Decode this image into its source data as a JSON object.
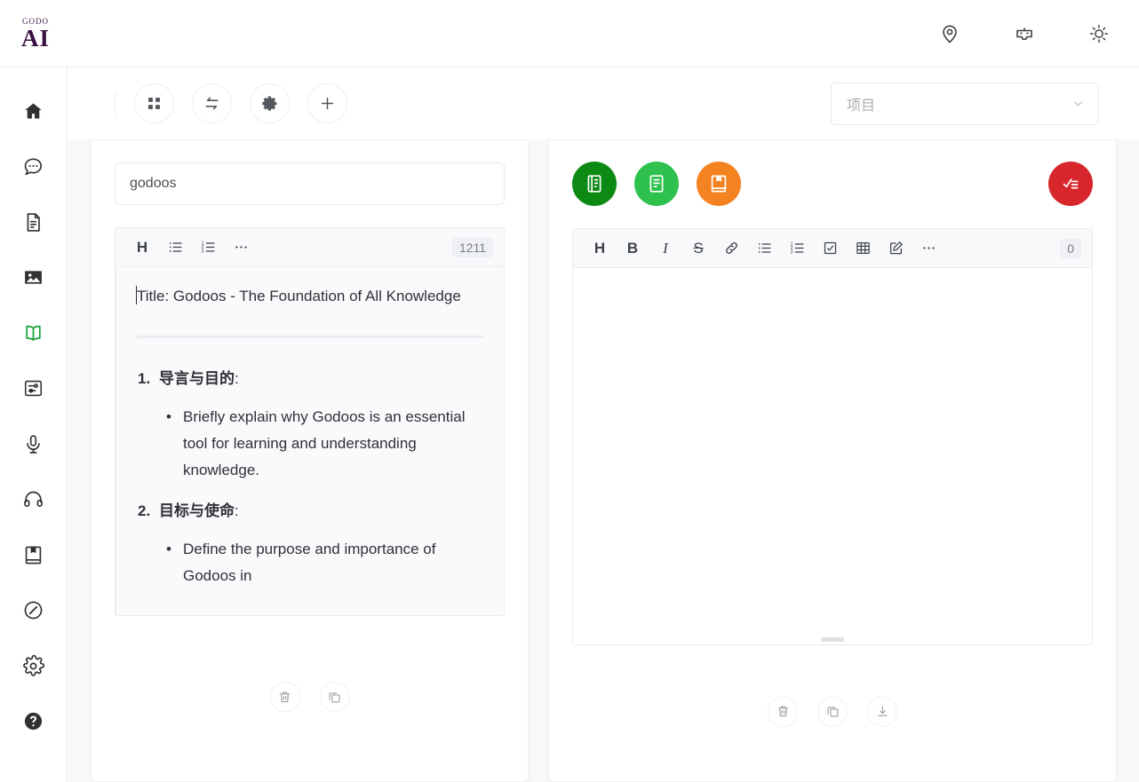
{
  "header": {
    "brand_top": "GODO",
    "brand_main": "AI",
    "icons": [
      {
        "name": "location-pin-icon",
        "label": "Location"
      },
      {
        "name": "robot-icon",
        "label": "Assistant"
      },
      {
        "name": "sun-icon",
        "label": "Theme"
      }
    ]
  },
  "sidebar": {
    "items": [
      {
        "name": "sidebar-item-home",
        "icon": "home-icon",
        "label": "Home",
        "active": false
      },
      {
        "name": "sidebar-item-chat",
        "icon": "chat-bubble-icon",
        "label": "Chat",
        "active": false
      },
      {
        "name": "sidebar-item-document",
        "icon": "document-icon",
        "label": "Document",
        "active": false
      },
      {
        "name": "sidebar-item-image",
        "icon": "image-icon",
        "label": "Image",
        "active": false
      },
      {
        "name": "sidebar-item-book",
        "icon": "open-book-icon",
        "label": "Knowledge",
        "active": true
      },
      {
        "name": "sidebar-item-settings-sliders",
        "icon": "sliders-icon",
        "label": "Tools",
        "active": false
      },
      {
        "name": "sidebar-item-voice",
        "icon": "microphone-icon",
        "label": "Voice",
        "active": false
      },
      {
        "name": "sidebar-item-audio",
        "icon": "headphones-icon",
        "label": "Audio",
        "active": false
      },
      {
        "name": "sidebar-item-library",
        "icon": "bookmark-book-icon",
        "label": "Library",
        "active": false
      },
      {
        "name": "sidebar-item-explore",
        "icon": "compass-icon",
        "label": "Explore",
        "active": false
      },
      {
        "name": "sidebar-item-settings",
        "icon": "gear-icon",
        "label": "Settings",
        "active": false
      },
      {
        "name": "sidebar-item-help",
        "icon": "help-circle-icon",
        "label": "Help",
        "active": false
      }
    ]
  },
  "toolbar": {
    "buttons": [
      {
        "name": "grid-view-button",
        "icon": "grid-icon",
        "label": "Grid"
      },
      {
        "name": "transfer-button",
        "icon": "swap-arrows-icon",
        "label": "Transfer"
      },
      {
        "name": "settings-button",
        "icon": "gear-icon",
        "label": "Settings"
      },
      {
        "name": "add-button",
        "icon": "plus-icon",
        "label": "Add"
      }
    ],
    "project_select": {
      "value": "项目",
      "placeholder": "项目",
      "chevron": "chevron-down-icon"
    }
  },
  "left_panel": {
    "name_input": {
      "value": "godoos",
      "placeholder": "godoos"
    },
    "editor": {
      "toolbar": [
        {
          "name": "heading-button",
          "glyph": "H",
          "type": "text"
        },
        {
          "name": "bullet-list-button",
          "icon": "bullet-list-icon",
          "type": "icon"
        },
        {
          "name": "ordered-list-button",
          "icon": "ordered-list-icon",
          "type": "icon"
        },
        {
          "name": "more-options-button",
          "icon": "ellipsis-icon",
          "type": "icon"
        }
      ],
      "char_count": "1211",
      "content": {
        "title": "Title: Godoos - The Foundation of All Knowledge",
        "sections": [
          {
            "heading": "导言与目的",
            "colon": ":",
            "bullets": [
              "Briefly explain why Godoos is an essential tool for learning and understanding knowledge."
            ]
          },
          {
            "heading": "目标与使命",
            "colon": ":",
            "bullets": [
              "Define the purpose and importance of Godoos in"
            ]
          }
        ]
      }
    },
    "footer_buttons": [
      {
        "name": "delete-button",
        "icon": "trash-icon",
        "label": "Delete"
      },
      {
        "name": "copy-button",
        "icon": "copy-icon",
        "label": "Copy"
      }
    ]
  },
  "right_panel": {
    "action_circles": [
      {
        "name": "generate-outline-button",
        "icon": "article-icon",
        "color": "#0c8a14",
        "label": "Outline"
      },
      {
        "name": "generate-content-button",
        "icon": "document-lines-icon",
        "color": "#2fc14e",
        "label": "Content"
      },
      {
        "name": "generate-book-button",
        "icon": "bookmark-book-icon",
        "color": "#f58220",
        "label": "Book"
      },
      {
        "name": "task-check-button",
        "icon": "checklist-icon",
        "color": "#d7262c",
        "label": "Tasks"
      }
    ],
    "editor": {
      "toolbar": [
        {
          "name": "heading-button",
          "glyph": "H",
          "type": "text"
        },
        {
          "name": "bold-button",
          "glyph": "B",
          "type": "text"
        },
        {
          "name": "italic-button",
          "glyph": "I",
          "type": "text"
        },
        {
          "name": "strikethrough-button",
          "glyph": "S",
          "type": "text"
        },
        {
          "name": "link-button",
          "icon": "link-icon",
          "type": "icon"
        },
        {
          "name": "bullet-list-button",
          "icon": "bullet-list-icon",
          "type": "icon"
        },
        {
          "name": "ordered-list-button",
          "icon": "ordered-list-icon",
          "type": "icon"
        },
        {
          "name": "checkbox-button",
          "icon": "checkbox-icon",
          "type": "icon"
        },
        {
          "name": "table-button",
          "icon": "table-icon",
          "type": "icon"
        },
        {
          "name": "edit-button",
          "icon": "pencil-square-icon",
          "type": "icon"
        },
        {
          "name": "more-options-button",
          "icon": "ellipsis-icon",
          "type": "icon"
        }
      ],
      "char_count": "0",
      "content": ""
    },
    "footer_buttons": [
      {
        "name": "delete-button",
        "icon": "trash-icon",
        "label": "Delete"
      },
      {
        "name": "copy-button",
        "icon": "copy-icon",
        "label": "Copy"
      },
      {
        "name": "download-button",
        "icon": "download-icon",
        "label": "Download"
      }
    ]
  },
  "colors": {
    "accent_green": "#19a33a",
    "dark_green": "#0c8a14",
    "bright_green": "#2fc14e",
    "orange": "#f58220",
    "red": "#d7262c",
    "brand_purple": "#36113f",
    "page_bg": "#f7f8fa"
  }
}
